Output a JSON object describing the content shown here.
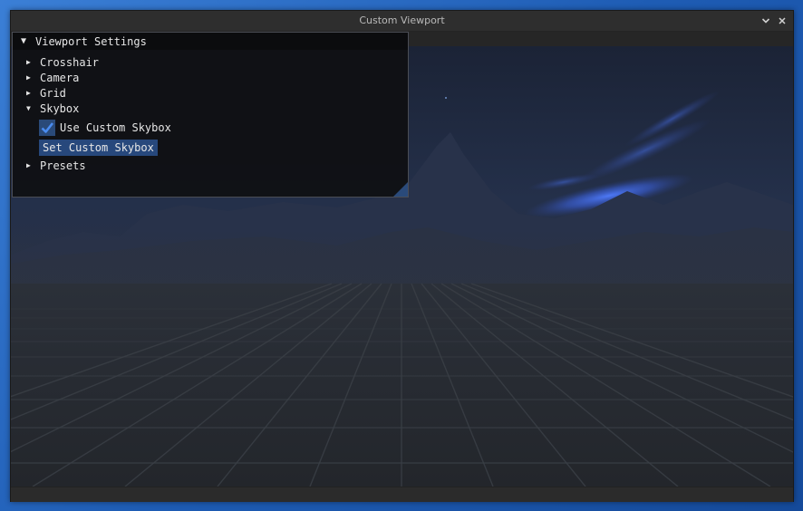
{
  "window": {
    "title": "Custom Viewport"
  },
  "panel": {
    "header": "Viewport Settings",
    "items": [
      {
        "label": "Crosshair",
        "expanded": false
      },
      {
        "label": "Camera",
        "expanded": false
      },
      {
        "label": "Grid",
        "expanded": false
      },
      {
        "label": "Skybox",
        "expanded": true
      },
      {
        "label": "Presets",
        "expanded": false
      }
    ],
    "skybox": {
      "use_custom_label": "Use Custom Skybox",
      "use_custom_checked": true,
      "set_button_label": "Set Custom Skybox"
    }
  },
  "colors": {
    "accent": "#4a8cf0",
    "panel_bg": "#101114",
    "button_bg": "#27487c",
    "checkbox_bg": "#2a4a79"
  },
  "icons": {
    "collapsed": "triangle-right-icon",
    "expanded": "triangle-down-icon",
    "minimize": "chevron-down-icon",
    "close": "close-icon",
    "check": "checkmark-icon"
  }
}
